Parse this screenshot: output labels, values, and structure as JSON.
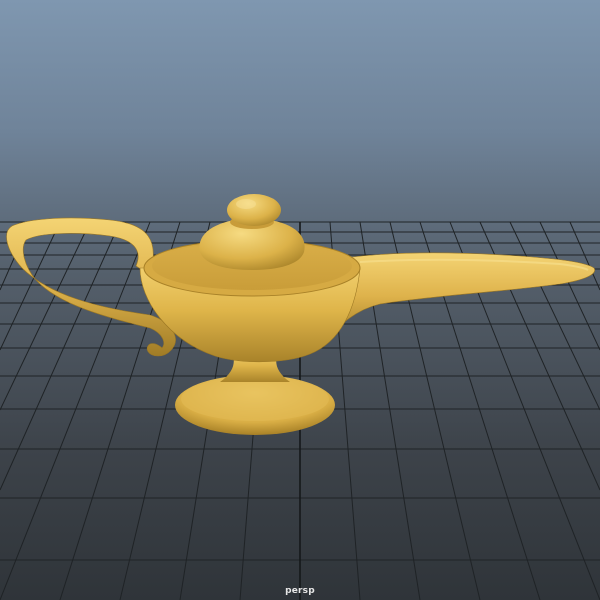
{
  "viewport": {
    "camera_label": "persp"
  },
  "scene": {
    "object": "genie-lamp",
    "material_color": "#e2b84e",
    "grid_color": "#1f2326",
    "background_top": "#7f97b0",
    "background_bottom": "#2f3439"
  }
}
